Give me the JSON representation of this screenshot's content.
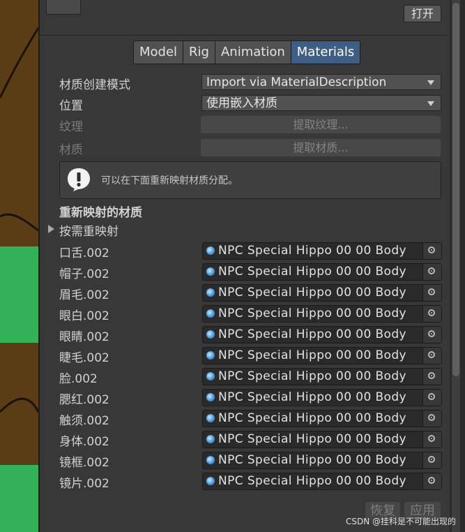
{
  "header": {
    "open_button": "打开"
  },
  "tabs": [
    {
      "label": "Model",
      "active": false
    },
    {
      "label": "Rig",
      "active": false
    },
    {
      "label": "Animation",
      "active": false
    },
    {
      "label": "Materials",
      "active": true
    }
  ],
  "settings": {
    "creation_mode_label": "材质创建模式",
    "creation_mode_value": "Import via MaterialDescription",
    "location_label": "位置",
    "location_value": "使用嵌入材质",
    "textures_label": "纹理",
    "textures_button": "提取纹理...",
    "materials_label": "材质",
    "materials_button": "提取材质..."
  },
  "help": {
    "icon": "exclamation-icon",
    "text": "可以在下面重新映射材质分配。"
  },
  "remapped": {
    "title": "重新映射的材质",
    "foldout_label": "按需重映射",
    "items": [
      {
        "name": "口舌.002",
        "value": "NPC Special Hippo 00 00 Body"
      },
      {
        "name": "帽子.002",
        "value": "NPC Special Hippo 00 00 Body"
      },
      {
        "name": "眉毛.002",
        "value": "NPC Special Hippo 00 00 Body"
      },
      {
        "name": "眼白.002",
        "value": "NPC Special Hippo 00 00 Body"
      },
      {
        "name": "眼睛.002",
        "value": "NPC Special Hippo 00 00 Body"
      },
      {
        "name": "睫毛.002",
        "value": "NPC Special Hippo 00 00 Body"
      },
      {
        "name": "脸.002",
        "value": "NPC Special Hippo 00 00 Body"
      },
      {
        "name": "腮红.002",
        "value": "NPC Special Hippo 00 00 Body"
      },
      {
        "name": "触须.002",
        "value": "NPC Special Hippo 00 00 Body"
      },
      {
        "name": "身体.002",
        "value": "NPC Special Hippo 00 00 Body"
      },
      {
        "name": "镜框.002",
        "value": "NPC Special Hippo 00 00 Body"
      },
      {
        "name": "镜片.002",
        "value": "NPC Special Hippo 00 00 Body"
      }
    ]
  },
  "footer": {
    "revert_button": "恢复",
    "apply_button": "应用"
  },
  "watermark": "CSDN @挂科是不可能出现的",
  "colors": {
    "panel": "#383838",
    "active_tab": "#3f5e86",
    "scene_green": "#33b25a",
    "scene_brown": "#5a3d14"
  }
}
